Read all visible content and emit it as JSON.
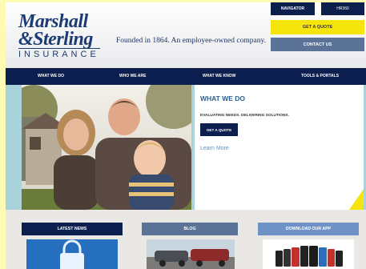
{
  "header": {
    "logo": {
      "line1": "Marshall",
      "line2": "&Sterling",
      "line3": "INSURANCE"
    },
    "tagline": "Founded in 1864. An employee-owned company.",
    "top_buttons": {
      "navigator": "NAVIGATOR",
      "hr360": "HR360"
    },
    "get_quote": "GET A QUOTE",
    "contact_us": "CONTACT US"
  },
  "nav": {
    "items": [
      "WHAT WE DO",
      "WHO WE ARE",
      "WHAT WE KNOW",
      "TOOLS & PORTALS"
    ]
  },
  "hero": {
    "title": "WHAT WE DO",
    "subtitle": "EVALUATING NEEDS. DELIVERING SOLUTIONS.",
    "button": "GET A QUOTE",
    "link": "Learn More"
  },
  "cards": [
    {
      "title": "LATEST NEWS"
    },
    {
      "title": "BLOG"
    },
    {
      "title": "DOWNLOAD OUR APP"
    }
  ],
  "colors": {
    "navy": "#0c1f4f",
    "yellow": "#f6e40d",
    "slate": "#5a7396",
    "hero_bg": "#a9d2db",
    "page_bg": "#fdfab4"
  },
  "icons": [
    "lock-icon"
  ]
}
